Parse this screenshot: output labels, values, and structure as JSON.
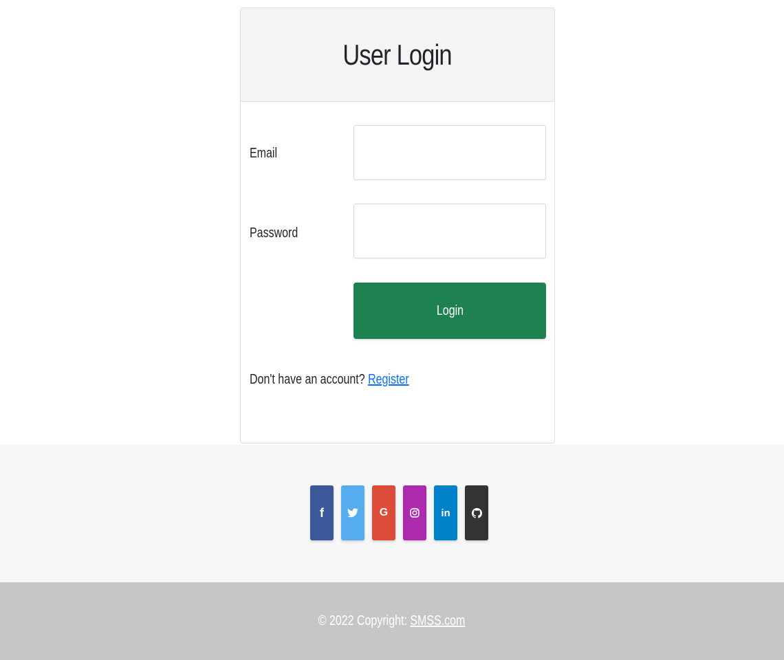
{
  "login_card": {
    "title": "User Login",
    "email_label": "Email",
    "email_value": "",
    "email_placeholder": "",
    "password_label": "Password",
    "password_value": "",
    "password_placeholder": "",
    "login_button_label": "Login",
    "register_prompt": "Don't have an account?",
    "register_link_label": "Register"
  },
  "social": {
    "buttons": [
      {
        "icon": "facebook-icon",
        "glyph": "f",
        "color": "#3b5998"
      },
      {
        "icon": "twitter-icon",
        "glyph": "",
        "color": "#55acee"
      },
      {
        "icon": "google-icon",
        "glyph": "G",
        "color": "#dd4b39"
      },
      {
        "icon": "instagram-icon",
        "glyph": "",
        "color": "#ac2bac"
      },
      {
        "icon": "linkedin-icon",
        "glyph": "in",
        "color": "#0082ca"
      },
      {
        "icon": "github-icon",
        "glyph": "",
        "color": "#333333"
      }
    ]
  },
  "footer": {
    "copyright_prefix": "© 2022 Copyright:",
    "copyright_link": "SMSS.com",
    "background": "#c6c6c6"
  },
  "colors": {
    "login_button": "#1e8150",
    "link": "#0d6efd",
    "card_header": "#f4f4f4",
    "social_section": "#f7f7f7"
  }
}
